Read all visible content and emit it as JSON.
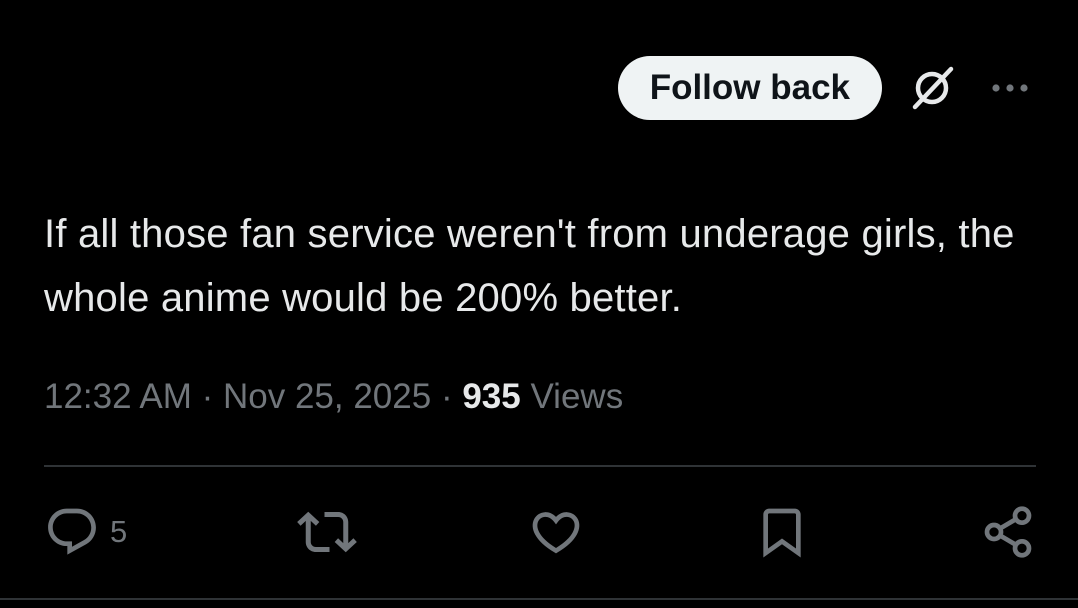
{
  "header": {
    "follow_label": "Follow back",
    "grok_icon": "grok-icon",
    "more_icon": "more-dots-icon"
  },
  "tweet": {
    "text": "If all those fan service weren't from underage girls, the whole anime would be 200% better."
  },
  "meta": {
    "time": "12:32 AM",
    "separator": " · ",
    "date": "Nov 25, 2025",
    "views_count": "935",
    "views_label": " Views"
  },
  "actions": {
    "reply_count": "5",
    "icons": [
      "reply-icon",
      "retweet-icon",
      "like-icon",
      "bookmark-icon",
      "share-icon"
    ]
  },
  "colors": {
    "background": "#000000",
    "text_primary": "#e7e9ea",
    "text_secondary": "#71767b",
    "divider": "#2f3336",
    "button_bg": "#eff3f4"
  }
}
